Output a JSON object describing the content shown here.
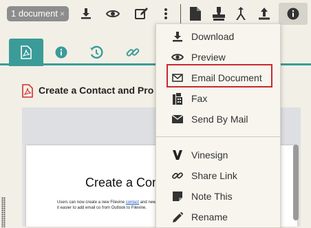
{
  "toolbar": {
    "doc_chip_label": "1 document",
    "doc_chip_close": "×",
    "icons": [
      "download-icon",
      "eye-icon",
      "edit-icon",
      "kebab-icon",
      "document-icon",
      "stamp-icon",
      "merge-icon",
      "upload-icon",
      "info-icon"
    ]
  },
  "tabs": [
    "pdf-tab",
    "info-tab",
    "history-tab",
    "link-tab"
  ],
  "document": {
    "title": "Create a Contact and Pro",
    "page_heading": "Create a Conta",
    "page_text_before_link": "Users can now create a new Filevine ",
    "page_link": "contact",
    "page_text_after_link": " and new functionality makes it easier to add email co from Outlook to Filevine."
  },
  "menu": {
    "items": [
      {
        "label": "Download",
        "icon": "download-icon"
      },
      {
        "label": "Preview",
        "icon": "eye-icon"
      },
      {
        "label": "Email Document",
        "icon": "envelope-icon"
      },
      {
        "label": "Fax",
        "icon": "fax-icon"
      },
      {
        "label": "Send By Mail",
        "icon": "mail-icon"
      },
      {
        "label": "Vinesign",
        "icon": "vinesign-icon"
      },
      {
        "label": "Share Link",
        "icon": "link-icon"
      },
      {
        "label": "Note This",
        "icon": "note-icon"
      },
      {
        "label": "Rename",
        "icon": "pencil-icon"
      }
    ],
    "highlighted": "Email Document"
  },
  "colors": {
    "accent": "#3b9b98",
    "highlight_border": "#c8292e",
    "pdf_red": "#d0312d",
    "background": "#f2efe6"
  }
}
